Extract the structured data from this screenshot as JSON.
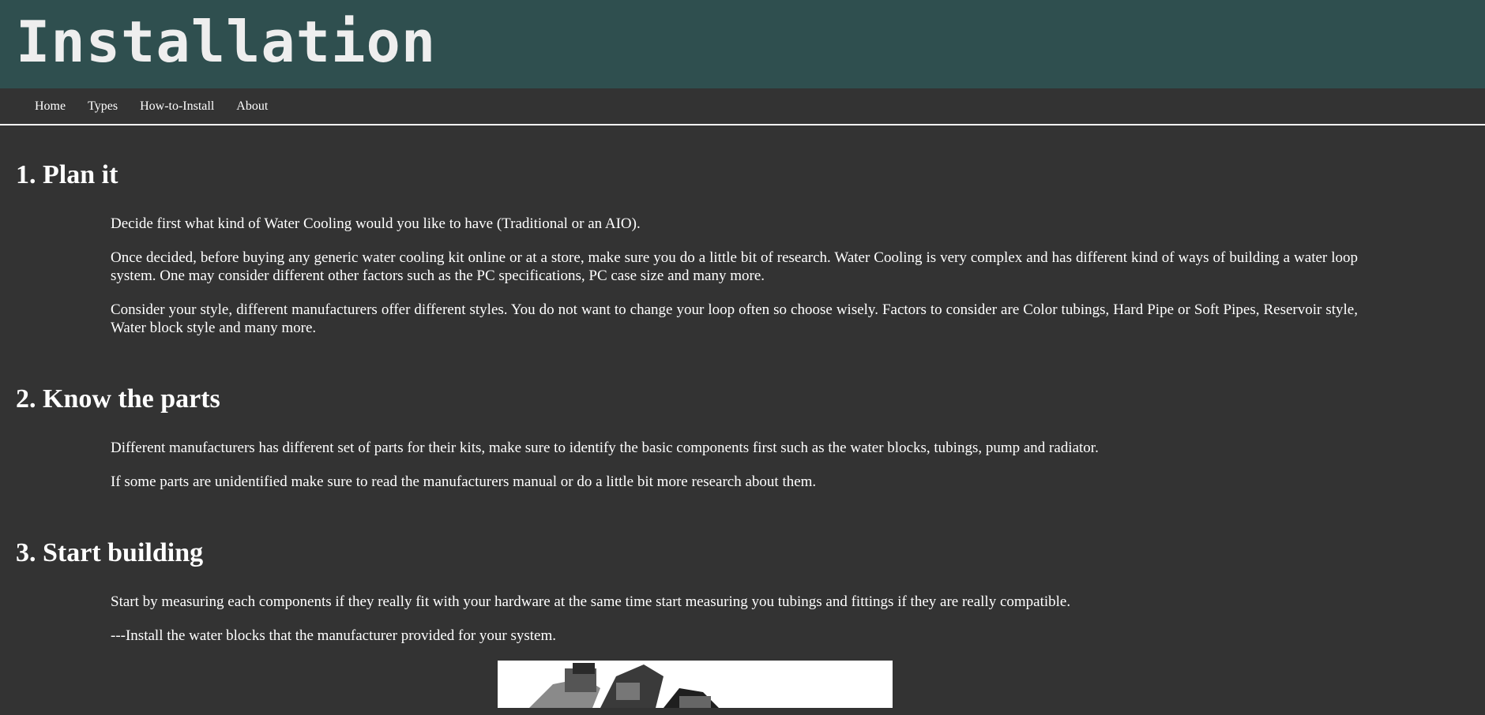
{
  "header": {
    "title": "Installation"
  },
  "nav": {
    "items": [
      {
        "label": "Home"
      },
      {
        "label": "Types"
      },
      {
        "label": "How-to-Install"
      },
      {
        "label": "About"
      }
    ]
  },
  "sections": [
    {
      "heading": "1. Plan it",
      "paragraphs": [
        "Decide first what kind of Water Cooling would you like to have (Traditional or an AIO).",
        "Once decided, before buying any generic water cooling kit online or at a store, make sure you do a little bit of research. Water Cooling is very complex and has different kind of ways of building a water loop system. One may consider different other factors such as the PC specifications, PC case size and many more.",
        "Consider your style, different manufacturers offer different styles. You do not want to change your loop often so choose wisely. Factors to consider are Color tubings, Hard Pipe or Soft Pipes, Reservoir style, Water block style and many more."
      ]
    },
    {
      "heading": "2. Know the parts",
      "paragraphs": [
        "Different manufacturers has different set of parts for their kits, make sure to identify the basic components first such as the water blocks, tubings, pump and radiator.",
        "If some parts are unidentified make sure to read the manufacturers manual or do a little bit more research about them."
      ]
    },
    {
      "heading": "3. Start building",
      "paragraphs": [
        "Start by measuring each components if they really fit with your hardware at the same time start measuring you tubings and fittings if they are really compatible.",
        "---Install the water blocks that the manufacturer provided for your system."
      ]
    }
  ],
  "colors": {
    "background": "#333333",
    "banner": "#2f4f4f",
    "text": "#ffffff"
  }
}
